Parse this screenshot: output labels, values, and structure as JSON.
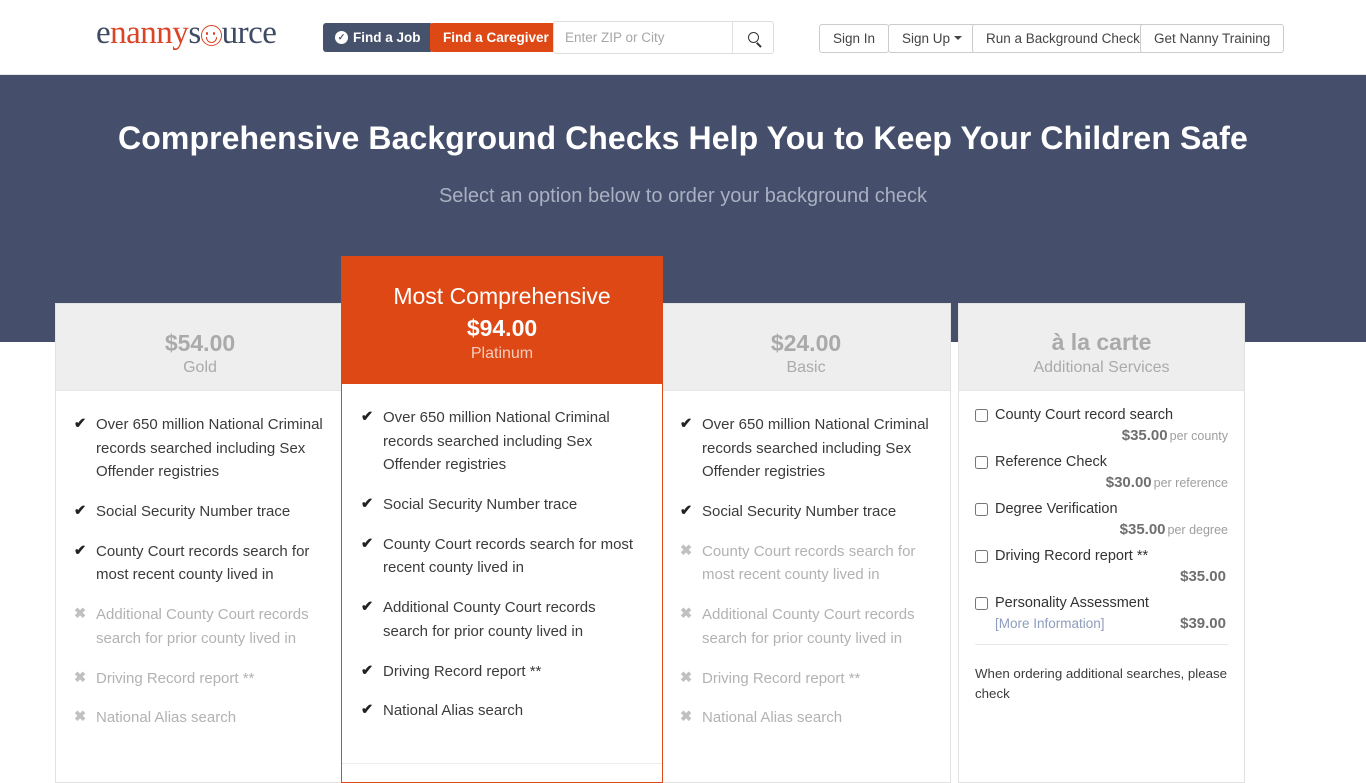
{
  "header": {
    "logo": {
      "part1": "e",
      "part2": "nanny",
      "part3": "s",
      "part4": "urce",
      "icon": "baby-face-icon"
    },
    "find_job_label": "Find a Job",
    "find_caregiver_label": "Find a Caregiver",
    "search": {
      "placeholder": "Enter ZIP or City",
      "value": ""
    },
    "sign_in_label": "Sign In",
    "sign_up_label": "Sign Up",
    "background_check_label": "Run a Background Check",
    "nanny_training_label": "Get Nanny Training",
    "accent_navy": "#454f6b",
    "accent_orange": "#dd4814"
  },
  "hero": {
    "title": "Comprehensive Background Checks Help You to Keep Your Children Safe",
    "subtitle": "Select an option below to order your background check"
  },
  "plans": [
    {
      "id": "gold",
      "price": "$54.00",
      "tier": "Gold",
      "features": [
        {
          "text": "Over 650 million National Criminal records searched including Sex Offender registries",
          "included": true
        },
        {
          "text": "Social Security Number trace",
          "included": true
        },
        {
          "text": "County Court records search for most recent county lived in",
          "included": true
        },
        {
          "text": "Additional County Court records search for prior county lived in",
          "included": false
        },
        {
          "text": "Driving Record report **",
          "included": false
        },
        {
          "text": "National Alias search",
          "included": false
        }
      ]
    },
    {
      "id": "platinum",
      "badge": "Most Comprehensive",
      "price": "$94.00",
      "tier": "Platinum",
      "features": [
        {
          "text": "Over 650 million National Criminal records searched including Sex Offender registries",
          "included": true
        },
        {
          "text": "Social Security Number trace",
          "included": true
        },
        {
          "text": "County Court records search for most recent county lived in",
          "included": true
        },
        {
          "text": "Additional County Court records search for prior county lived in",
          "included": true
        },
        {
          "text": "Driving Record report **",
          "included": true
        },
        {
          "text": "National Alias search",
          "included": true
        }
      ]
    },
    {
      "id": "basic",
      "price": "$24.00",
      "tier": "Basic",
      "features": [
        {
          "text": "Over 650 million National Criminal records searched including Sex Offender registries",
          "included": true
        },
        {
          "text": "Social Security Number trace",
          "included": true
        },
        {
          "text": "County Court records search for most recent county lived in",
          "included": false
        },
        {
          "text": "Additional County Court records search for prior county lived in",
          "included": false
        },
        {
          "text": "Driving Record report **",
          "included": false
        },
        {
          "text": "National Alias search",
          "included": false
        }
      ]
    }
  ],
  "alacarte": {
    "title": "à la carte",
    "subtitle": "Additional Services",
    "items": [
      {
        "label": "County Court record search",
        "price": "$35.00",
        "unit": "per county",
        "checked": false
      },
      {
        "label": "Reference Check",
        "price": "$30.00",
        "unit": "per reference",
        "checked": false
      },
      {
        "label": "Degree Verification",
        "price": "$35.00",
        "unit": "per degree",
        "checked": false
      },
      {
        "label": "Driving Record report **",
        "price": "$35.00",
        "unit": "",
        "checked": false
      },
      {
        "label": "Personality Assessment",
        "price": "$39.00",
        "unit": "",
        "checked": false,
        "more_info": "[More Information]"
      }
    ],
    "footer_note": "When ordering additional searches, please check"
  },
  "icons": {
    "check": "✔",
    "cross": "✖",
    "circle_check": "✓"
  }
}
